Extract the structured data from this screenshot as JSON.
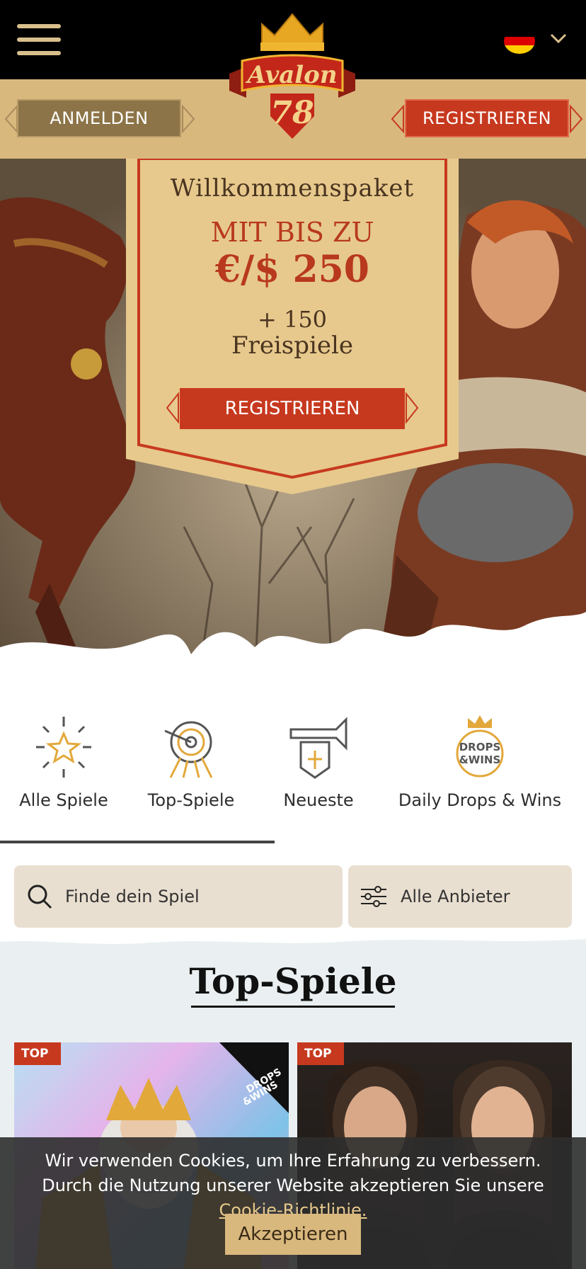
{
  "header": {
    "menu_icon": "hamburger-icon",
    "language_flag": "germany-flag-icon",
    "language_chevron": "chevron-down-icon",
    "logo_text": "Avalon",
    "logo_number": "78",
    "login_label": "ANMELDEN",
    "register_label": "REGISTRIEREN"
  },
  "promo": {
    "line1": "Willkommenspaket",
    "line2": "MIT BIS ZU",
    "line3": "€/$ 250",
    "line4": "+ 150",
    "line5": "Freispiele",
    "cta_label": "REGISTRIEREN"
  },
  "categories": [
    {
      "label": "Alle Spiele",
      "icon": "star-burst-icon"
    },
    {
      "label": "Top-Spiele",
      "icon": "target-icon"
    },
    {
      "label": "Neueste",
      "icon": "trumpet-icon"
    },
    {
      "label": "Daily Drops & Wins",
      "icon": "drops-wins-icon"
    }
  ],
  "search": {
    "placeholder": "Finde dein Spiel",
    "filter_label": "Alle Anbieter"
  },
  "top_games": {
    "title": "Top-Spiele",
    "cards": [
      {
        "badge": "TOP",
        "extra_badge": "DROPS & WINS"
      },
      {
        "badge": "TOP"
      }
    ]
  },
  "cookie": {
    "message": "Wir verwenden Cookies, um Ihre Erfahrung zu verbessern. Durch die Nutzung unserer Website akzeptieren Sie unsere ",
    "link": "Cookie-Richtlinie.",
    "accept": "Akzeptieren"
  },
  "colors": {
    "gold": "#d9b87e",
    "red": "#c7391f",
    "dark": "#000000"
  }
}
